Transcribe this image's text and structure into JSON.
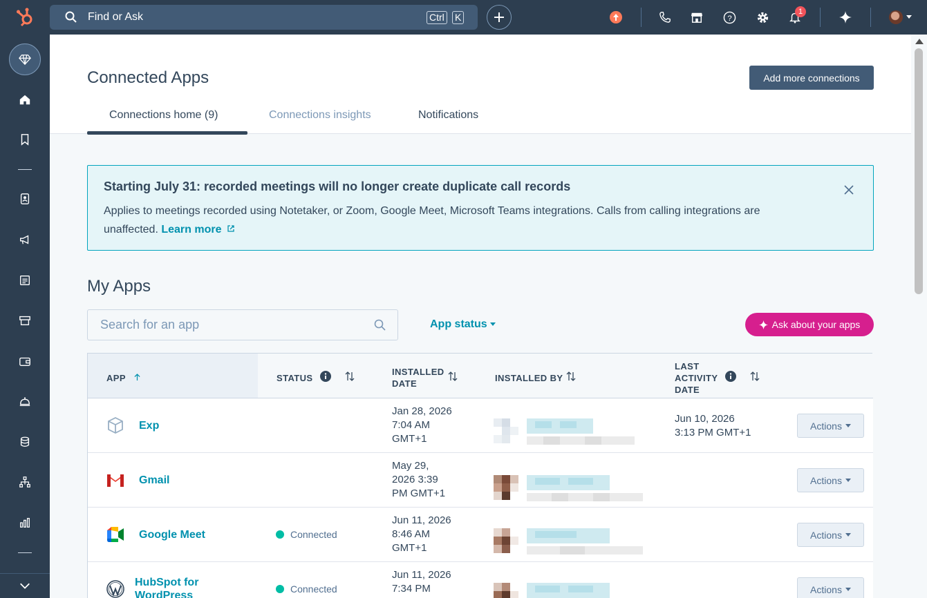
{
  "topbar": {
    "search_placeholder": "Find or Ask",
    "kbd_ctrl": "Ctrl",
    "kbd_k": "K",
    "notification_count": "1"
  },
  "header": {
    "title": "Connected Apps",
    "add_button": "Add more connections",
    "tabs": [
      {
        "label": "Connections home (9)",
        "active": true
      },
      {
        "label": "Connections insights",
        "active": false
      },
      {
        "label": "Notifications",
        "active": false
      }
    ]
  },
  "banner": {
    "title": "Starting July 31: recorded meetings will no longer create duplicate call records",
    "body": "Applies to meetings recorded using Notetaker, or Zoom, Google Meet, Microsoft Teams integrations. Calls from calling integrations are unaffected.",
    "link": "Learn more"
  },
  "my_apps": {
    "title": "My Apps",
    "search_placeholder": "Search for an app",
    "status_filter": "App status",
    "ask_button": "Ask about your apps"
  },
  "table": {
    "columns": {
      "app": "APP",
      "status": "STATUS",
      "installed_date": "INSTALLED DATE",
      "installed_by": "INSTALLED BY",
      "last_activity": "LAST ACTIVITY DATE"
    },
    "actions_label": "Actions",
    "rows": [
      {
        "name": "Exp",
        "icon": "cube-icon",
        "status": "",
        "installed_date": [
          "Jan 28, 2026",
          "7:04 AM",
          "GMT+1"
        ],
        "last_activity": [
          "Jun 10, 2026",
          "3:13 PM GMT+1"
        ]
      },
      {
        "name": "Gmail",
        "icon": "gmail-icon",
        "status": "",
        "installed_date": [
          "May 29,",
          "2026 3:39",
          "PM GMT+1"
        ],
        "last_activity": [
          "",
          ""
        ]
      },
      {
        "name": "Google Meet",
        "icon": "google-meet-icon",
        "status": "Connected",
        "installed_date": [
          "Jun 11, 2026",
          "8:46 AM",
          "GMT+1"
        ],
        "last_activity": [
          "",
          ""
        ]
      },
      {
        "name": "HubSpot for WordPress",
        "icon": "wordpress-icon",
        "status": "Connected",
        "installed_date": [
          "Jun 11, 2026",
          "7:34 PM",
          ""
        ],
        "last_activity": [
          "",
          ""
        ]
      }
    ]
  },
  "colors": {
    "nav": "#2d3e50",
    "link": "#0091ae",
    "connected": "#00bda5",
    "ask_button": "#d61f8e",
    "banner_border": "#00a4bd"
  }
}
